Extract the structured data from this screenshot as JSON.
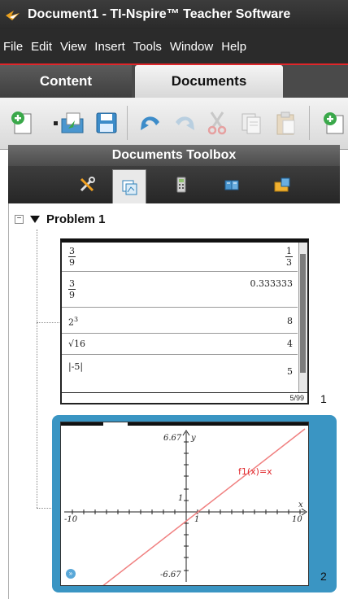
{
  "window": {
    "title": "Document1 - TI-Nspire™ Teacher Software"
  },
  "menu": {
    "items": [
      "File",
      "Edit",
      "View",
      "Insert",
      "Tools",
      "Window",
      "Help"
    ]
  },
  "tabs": {
    "content": "Content",
    "documents": "Documents"
  },
  "toolbar": {
    "icons": [
      "new-document-icon",
      "dropdown-arrow-icon",
      "open-document-icon",
      "save-icon",
      "undo-icon",
      "redo-icon",
      "cut-icon",
      "copy-icon",
      "paste-icon",
      "add-page-icon"
    ]
  },
  "toolbox": {
    "title": "Documents Toolbox",
    "tabs": [
      "tools-icon",
      "page-sorter-icon",
      "calculator-icon",
      "utilities-icon",
      "content-explorer-icon"
    ]
  },
  "tree": {
    "collapse_symbol": "−",
    "problem_label": "Problem 1"
  },
  "page1": {
    "rows": [
      {
        "lhs_num": "3",
        "lhs_den": "9",
        "rhs_num": "1",
        "rhs_den": "3"
      },
      {
        "lhs_num": "3",
        "lhs_den": "9",
        "rhs": "0.333333"
      },
      {
        "lhs": "2",
        "lhs_sup": "3",
        "rhs": "8"
      },
      {
        "lhs": "√16",
        "rhs": "4"
      },
      {
        "lhs": "|-5|",
        "rhs": "5"
      }
    ],
    "counter": "5/99",
    "page_number": "1"
  },
  "page2": {
    "y_max": "6.67",
    "y_min": "-6.67",
    "y_axis_label": "y",
    "x_axis_label": "x",
    "x_min": "-10",
    "x_max": "10",
    "x_tick": "1",
    "y_tick": "1",
    "function_label": "f1(x)=x",
    "page_number": "2",
    "nav_symbol": "»"
  },
  "colors": {
    "accent_red": "#e0262a",
    "selection_blue": "#3a95c3",
    "graph_line": "#f08080"
  }
}
